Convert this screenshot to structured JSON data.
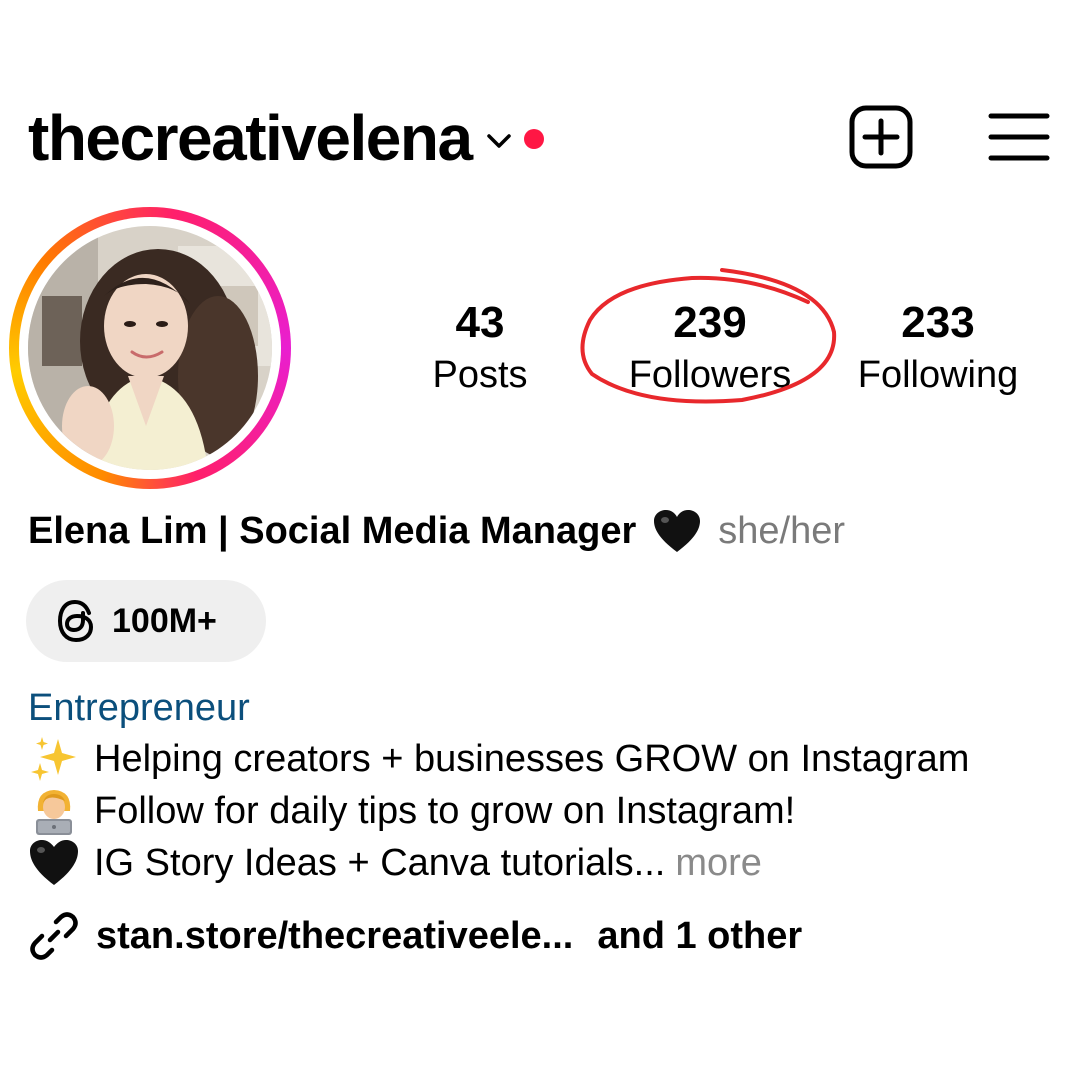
{
  "header": {
    "username": "thecreativelena",
    "dropdown_icon": "chevron-down-icon",
    "notification_dot_color": "#ff1744",
    "create_icon": "plus-square-icon",
    "menu_icon": "hamburger-menu-icon"
  },
  "profile": {
    "avatar_icon": "profile-photo",
    "story_ring_colors": [
      "#ff8a00",
      "#ffcc00",
      "#ff1f6b",
      "#e91fd0"
    ]
  },
  "stats": [
    {
      "value": "43",
      "label": "Posts"
    },
    {
      "value": "239",
      "label": "Followers"
    },
    {
      "value": "233",
      "label": "Following"
    }
  ],
  "annotation": {
    "color": "#e8282c"
  },
  "name_line": {
    "name": "Elena Lim | Social Media Manager",
    "emoji": "black-heart",
    "pronouns": "she/her"
  },
  "threads": {
    "icon": "threads-icon",
    "label": "100M+"
  },
  "bio": {
    "category": "Entrepreneur",
    "category_color": "#0b4f7c",
    "lines": [
      {
        "emoji": "sparkles",
        "text": "Helping creators + businesses GROW on Instagram"
      },
      {
        "emoji": "woman-technologist",
        "text": "Follow for daily tips to grow on Instagram!"
      },
      {
        "emoji": "black-heart",
        "text": "IG Story Ideas + Canva tutorials..."
      }
    ],
    "more_label": "more"
  },
  "link": {
    "icon": "link-icon",
    "url": "stan.store/thecreativeele...",
    "extra": "and 1 other"
  }
}
